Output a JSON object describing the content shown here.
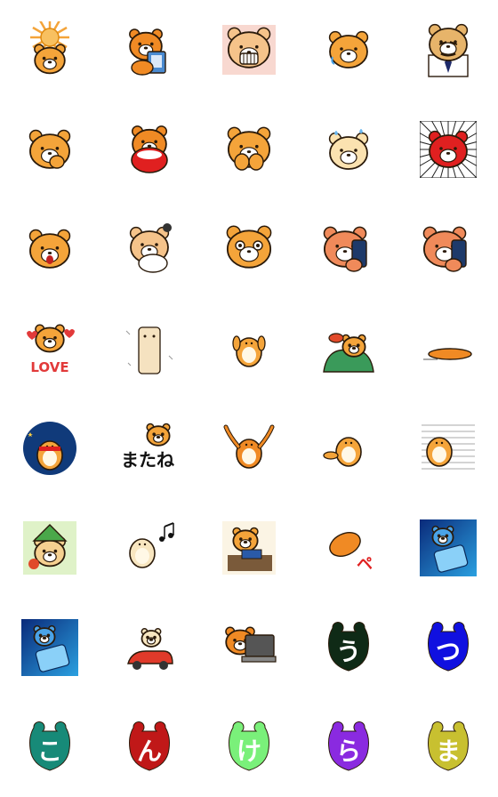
{
  "sheet": {
    "title": "",
    "background": "#ffffff"
  },
  "palette": {
    "bear_orange": "#f4a43a",
    "bear_cream": "#fbe9c4",
    "outline": "#2a1a0a",
    "red": "#e02020",
    "blue_bg": "#1c6fb8",
    "love_red": "#e23a3a"
  },
  "stickers": [
    {
      "name": "sun-bear",
      "icon": "bear-sun-icon",
      "body": "#f4a43a"
    },
    {
      "name": "bear-with-phone-notes",
      "icon": "bear-notebook-icon",
      "body": "#f08a24"
    },
    {
      "name": "bear-grin-effort",
      "icon": "bear-grin-icon",
      "body": "#f5c38a"
    },
    {
      "name": "bear-head-sweat",
      "icon": "bear-head-icon",
      "body": "#f4a43a"
    },
    {
      "name": "bear-suit-mustache",
      "icon": "bear-suit-icon",
      "body": "#e7b46a"
    },
    {
      "name": "bear-hand-mouth",
      "icon": "bear-shy-icon",
      "body": "#f4a43a"
    },
    {
      "name": "bear-shout",
      "icon": "bear-shout-icon",
      "body": "#f08a24"
    },
    {
      "name": "bear-cover-mouth",
      "icon": "bear-cover-icon",
      "body": "#f4a43a"
    },
    {
      "name": "bear-cry-sweat",
      "icon": "bear-cry-icon",
      "body": "#fbe2b0"
    },
    {
      "name": "red-bear-shock",
      "icon": "bear-red-shock-icon",
      "body": "#e02020"
    },
    {
      "name": "bear-surprised",
      "icon": "bear-surprised-icon",
      "body": "#f4a43a"
    },
    {
      "name": "bear-sleeping-blanket",
      "icon": "bear-sleep-icon",
      "body": "#f5c38a"
    },
    {
      "name": "bear-big-eyes",
      "icon": "bear-eyes-icon",
      "body": "#f4a43a"
    },
    {
      "name": "bear-phone-left",
      "icon": "bear-phone-icon",
      "body": "#f08a5a"
    },
    {
      "name": "bear-phone-right",
      "icon": "bear-phone2-icon",
      "body": "#f08a5a"
    },
    {
      "name": "bear-love",
      "icon": "bear-love-icon",
      "body": "#f4a43a",
      "text": "LOVE"
    },
    {
      "name": "bear-wrapped",
      "icon": "bear-wrapped-icon",
      "body": "#f5e2c0"
    },
    {
      "name": "bear-happy-jump",
      "icon": "bear-jump-icon",
      "body": "#f4a43a"
    },
    {
      "name": "bear-blanket-green",
      "icon": "bear-blanket-icon",
      "body": "#f4a43a"
    },
    {
      "name": "bear-lying-flat",
      "icon": "bear-flat-icon",
      "body": "#f08a24"
    },
    {
      "name": "bear-night-scarf",
      "icon": "bear-night-icon",
      "body": "#f4a43a"
    },
    {
      "name": "bear-matane",
      "icon": "bear-matane-icon",
      "body": "#f4a43a",
      "text": "またね"
    },
    {
      "name": "bear-arms-up",
      "icon": "bear-armsup-icon",
      "body": "#f08a24"
    },
    {
      "name": "bear-stretch",
      "icon": "bear-stretch-icon",
      "body": "#f4a43a"
    },
    {
      "name": "bear-running-lines",
      "icon": "bear-run-icon",
      "body": "#f4a43a"
    },
    {
      "name": "bear-green-hat",
      "icon": "bear-hat-icon",
      "body": "#f5d090"
    },
    {
      "name": "bear-music",
      "icon": "bear-music-icon",
      "body": "#f8e6c0"
    },
    {
      "name": "bear-laptop-desk",
      "icon": "bear-desk-icon",
      "body": "#f4a43a"
    },
    {
      "name": "bear-flying-pe",
      "icon": "bear-pe-icon",
      "body": "#f08a24",
      "text": "ペ"
    },
    {
      "name": "bear-blue-sleep",
      "icon": "bear-bluesleep-icon",
      "body": "#4aa3e8"
    },
    {
      "name": "bear-blue-sleep-2",
      "icon": "bear-bluesleep2-icon",
      "body": "#4aa3e8"
    },
    {
      "name": "bear-car",
      "icon": "bear-car-icon",
      "body": "#f8e6c0"
    },
    {
      "name": "bear-laptop",
      "icon": "bear-laptop-icon",
      "body": "#f08a24"
    },
    {
      "name": "glyph-u",
      "icon": "glyph-u-icon",
      "body": "#0f2a16",
      "text": "う"
    },
    {
      "name": "glyph-tsu",
      "icon": "glyph-tsu-icon",
      "body": "#1010e0",
      "text": "つ"
    },
    {
      "name": "glyph-ko",
      "icon": "glyph-ko-icon",
      "body": "#178a78",
      "text": "こ"
    },
    {
      "name": "glyph-n",
      "icon": "glyph-n-icon",
      "body": "#c01818",
      "text": "ん"
    },
    {
      "name": "glyph-ke",
      "icon": "glyph-ke-icon",
      "body": "#7af07a",
      "text": "け"
    },
    {
      "name": "glyph-ra",
      "icon": "glyph-ra-icon",
      "body": "#8a2ae0",
      "text": "ら"
    },
    {
      "name": "glyph-ma",
      "icon": "glyph-ma-icon",
      "body": "#c8c030",
      "text": "ま"
    }
  ]
}
